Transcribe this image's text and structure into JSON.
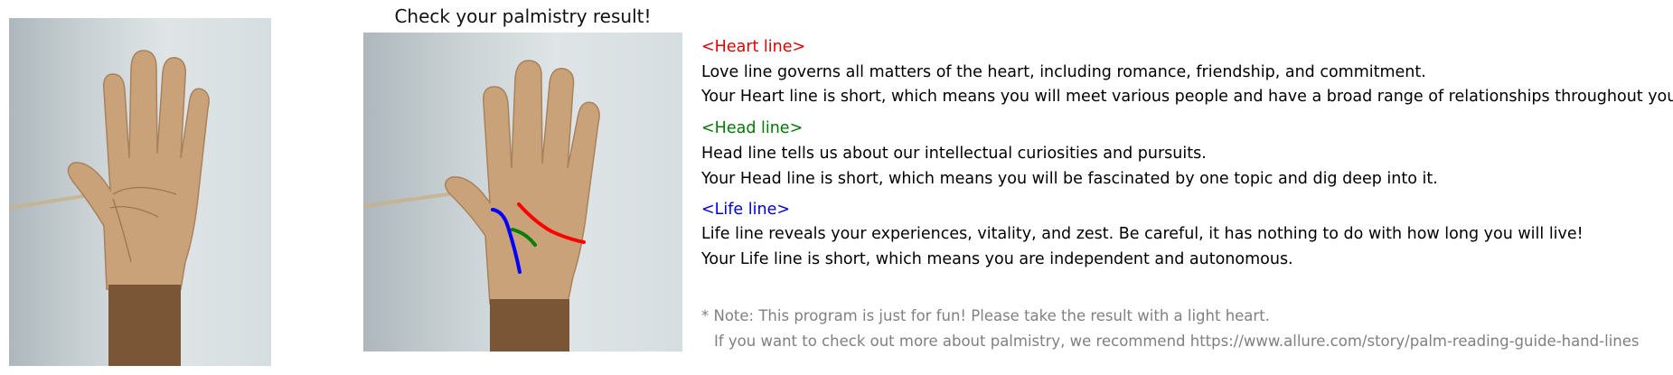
{
  "title": "Check your palmistry result!",
  "sections": {
    "heart": {
      "header": "<Heart line>",
      "desc": "Love line governs all matters of the heart, including romance, friendship, and commitment.",
      "result": "Your Heart line is short, which means you will meet various people and have a broad range of relationships throughout your life.",
      "color": "#e00000"
    },
    "head": {
      "header": "<Head line>",
      "desc": "Head line tells us about our intellectual curiosities and pursuits.",
      "result": "Your Head line is short, which means you will be fascinated by one topic and dig deep into it.",
      "color": "#007a00"
    },
    "life": {
      "header": "<Life line>",
      "desc": "Life line reveals your experiences, vitality, and zest. Be careful, it has nothing to do with how long you will live!",
      "result": "Your Life line is short, which means you are independent and autonomous.",
      "color": "#0000d8"
    }
  },
  "note": {
    "line1": "* Note: This program is just for fun! Please take the result with a light heart.",
    "line2": "If you want to check out more about palmistry, we recommend https://www.allure.com/story/palm-reading-guide-hand-lines"
  }
}
